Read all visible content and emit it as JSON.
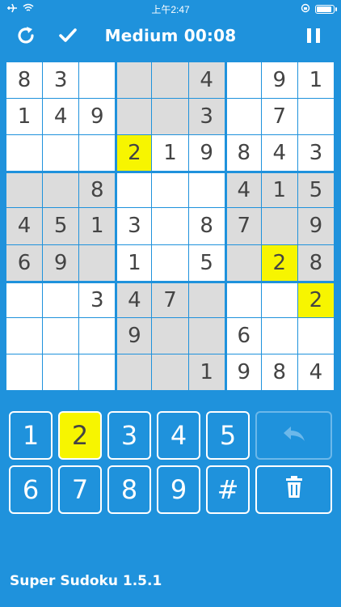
{
  "status": {
    "time": "上午2:47"
  },
  "header": {
    "title": "Medium 00:08"
  },
  "board": [
    [
      "8",
      "3",
      "",
      "",
      "",
      "4",
      "",
      "9",
      "1"
    ],
    [
      "1",
      "4",
      "9",
      "",
      "",
      "3",
      "",
      "7",
      ""
    ],
    [
      "",
      "",
      "",
      "2",
      "1",
      "9",
      "8",
      "4",
      "3"
    ],
    [
      "",
      "",
      "8",
      "",
      "",
      "",
      "4",
      "1",
      "5"
    ],
    [
      "4",
      "5",
      "1",
      "3",
      "",
      "8",
      "7",
      "",
      "9"
    ],
    [
      "6",
      "9",
      "",
      "1",
      "",
      "5",
      "",
      "2",
      "8"
    ],
    [
      "",
      "",
      "3",
      "4",
      "7",
      "",
      "",
      "",
      "2"
    ],
    [
      "",
      "",
      "",
      "9",
      "",
      "",
      "6",
      "",
      ""
    ],
    [
      "",
      "",
      "",
      "",
      "",
      "1",
      "9",
      "8",
      "4"
    ]
  ],
  "shaded": [
    "0-3",
    "0-4",
    "0-5",
    "1-3",
    "1-4",
    "1-5",
    "3-0",
    "3-1",
    "3-2",
    "3-6",
    "3-7",
    "3-8",
    "4-0",
    "4-1",
    "4-2",
    "4-6",
    "4-7",
    "4-8",
    "5-0",
    "5-1",
    "5-2",
    "5-6",
    "5-7",
    "5-8",
    "6-3",
    "6-4",
    "6-5",
    "7-3",
    "7-4",
    "7-5",
    "8-3",
    "8-4",
    "8-5"
  ],
  "highlighted": [
    "2-3",
    "5-7",
    "6-8"
  ],
  "keypad": {
    "row1": [
      "1",
      "2",
      "3",
      "4",
      "5"
    ],
    "row2": [
      "6",
      "7",
      "8",
      "9",
      "#"
    ],
    "selected": "2"
  },
  "footer": {
    "app_name": "Super Sudoku 1.5.1"
  }
}
